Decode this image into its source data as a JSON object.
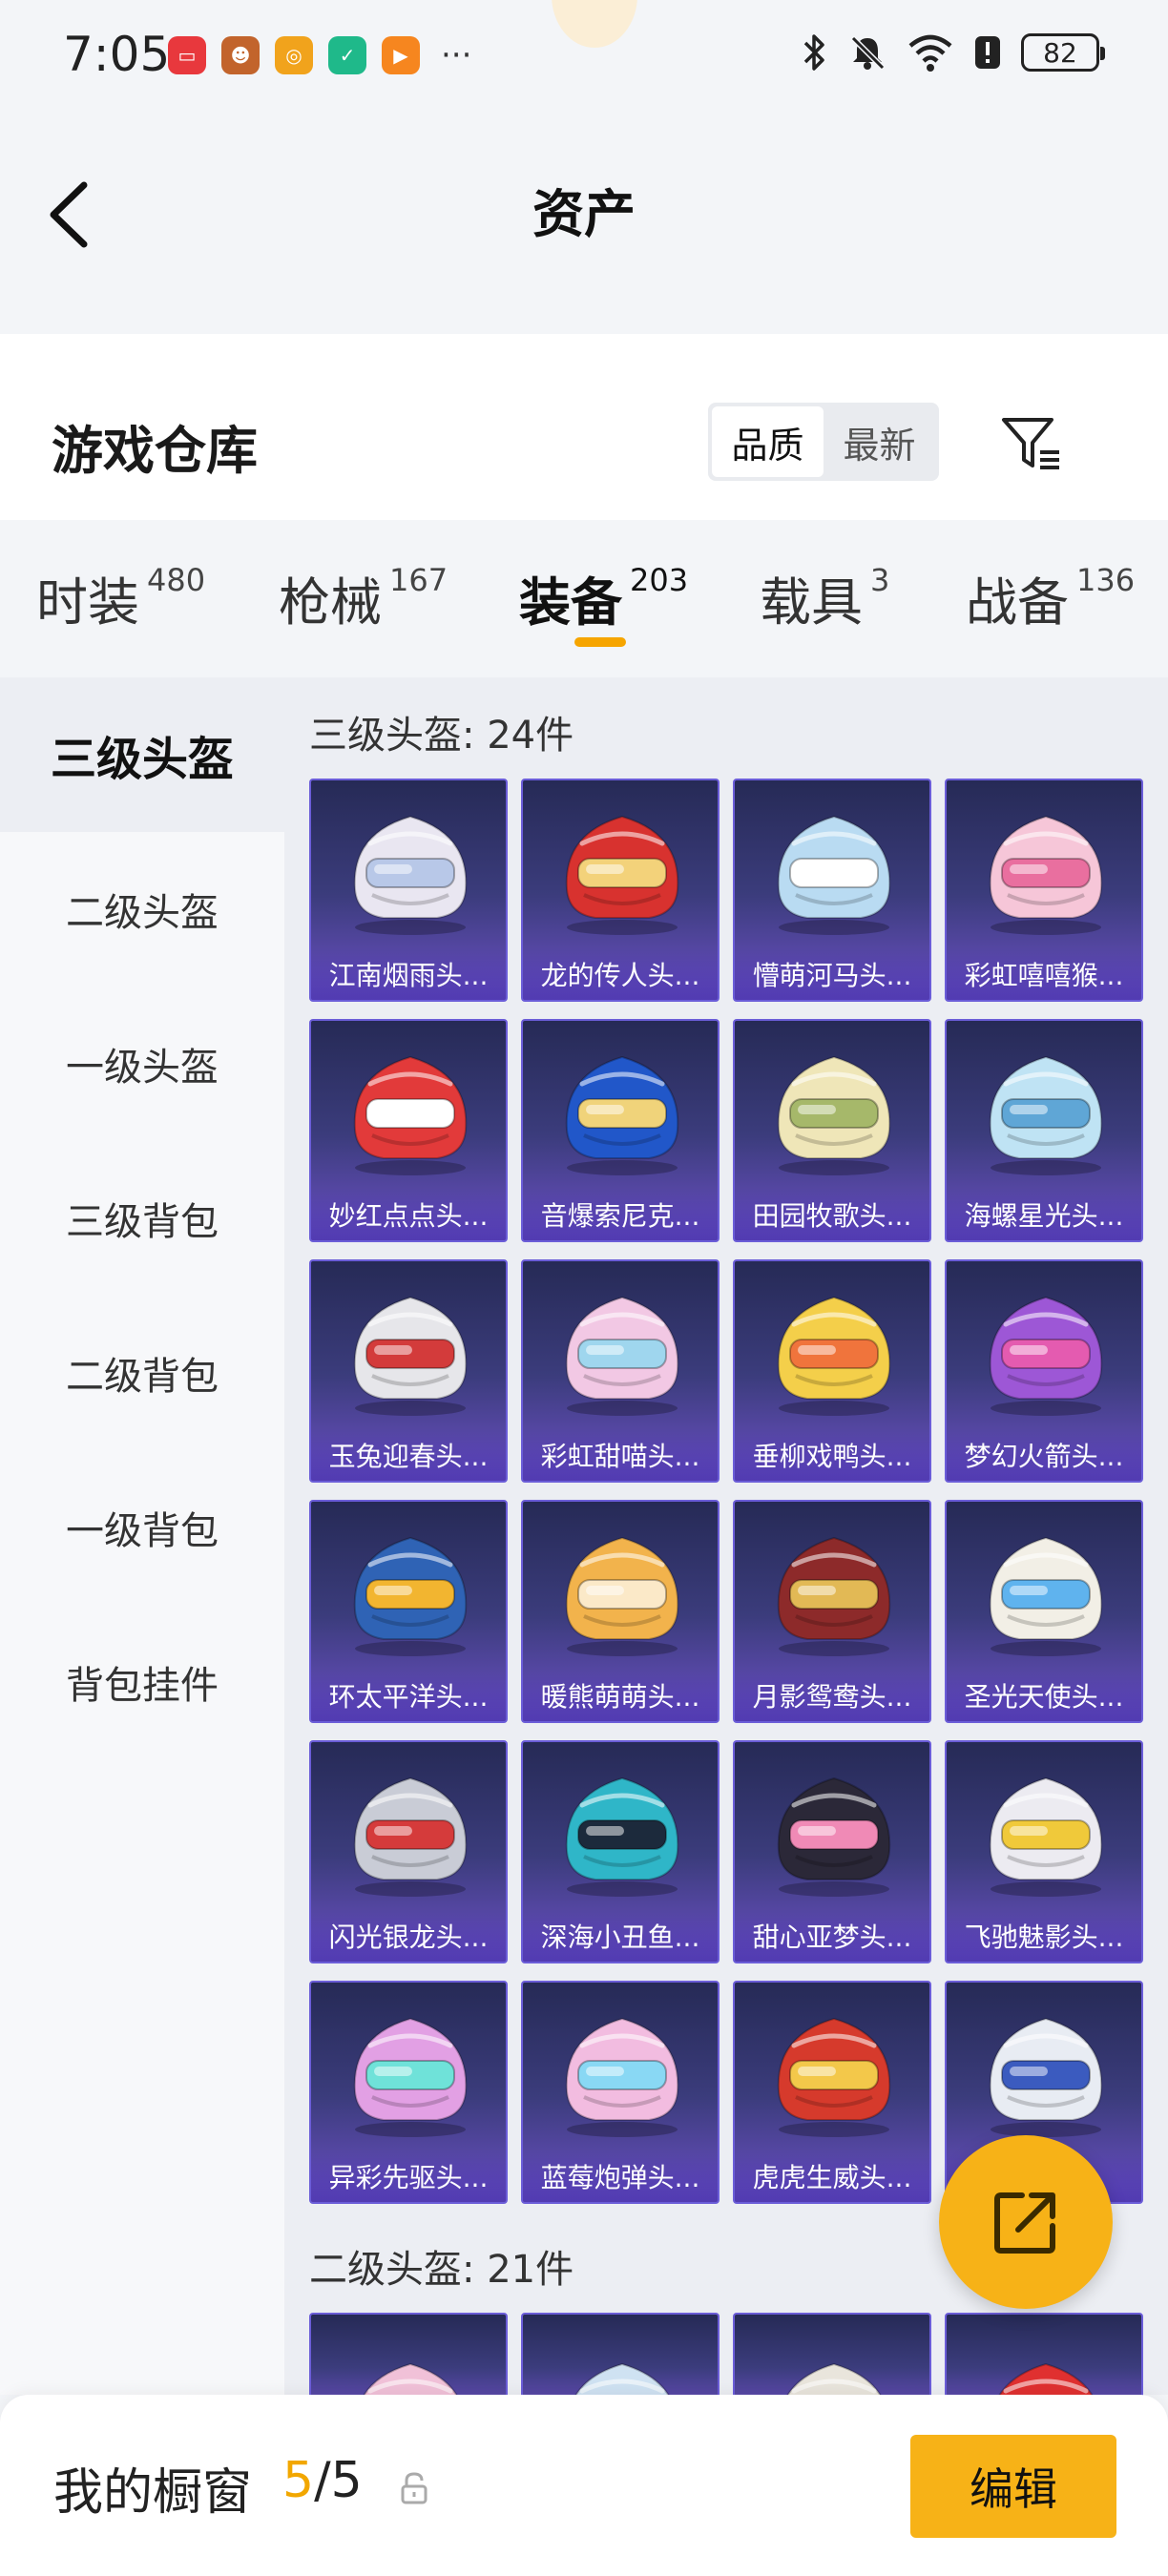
{
  "status_bar": {
    "time": "7:05",
    "apps": [
      {
        "name": "huawei-app-icon",
        "color": "#e8383d",
        "glyph": "▭"
      },
      {
        "name": "game-avatar-icon",
        "color": "#c2642c",
        "glyph": "☻"
      },
      {
        "name": "music-app-icon",
        "color": "#f1a31c",
        "glyph": "◎"
      },
      {
        "name": "security-app-icon",
        "color": "#1fb98a",
        "glyph": "✓"
      },
      {
        "name": "video-app-icon",
        "color": "#f6861f",
        "glyph": "▶"
      }
    ],
    "more": "···",
    "battery": "82"
  },
  "header": {
    "title": "资产"
  },
  "warehouse": {
    "title": "游戏仓库",
    "sort_options": [
      "品质",
      "最新"
    ],
    "active_sort": "品质"
  },
  "tabs": [
    {
      "label": "时装",
      "count": "480"
    },
    {
      "label": "枪械",
      "count": "167"
    },
    {
      "label": "装备",
      "count": "203",
      "active": true
    },
    {
      "label": "载具",
      "count": "3"
    },
    {
      "label": "战备",
      "count": "136"
    }
  ],
  "sidebar": {
    "items": [
      "三级头盔",
      "二级头盔",
      "一级头盔",
      "三级背包",
      "二级背包",
      "一级背包",
      "背包挂件"
    ],
    "active": "三级头盔"
  },
  "sections": [
    {
      "title": "三级头盔: 24件",
      "items": [
        {
          "name": "江南烟雨头...",
          "color": "#e9e6f1",
          "accent": "#b8c8e8"
        },
        {
          "name": "龙的传人头...",
          "color": "#d8322f",
          "accent": "#f3d27a"
        },
        {
          "name": "懵萌河马头...",
          "color": "#b9dbf2",
          "accent": "#ffffff"
        },
        {
          "name": "彩虹嘻嘻猴...",
          "color": "#f6c6d8",
          "accent": "#e96f9f"
        },
        {
          "name": "妙红点点头...",
          "color": "#e23a3a",
          "accent": "#ffffff"
        },
        {
          "name": "音爆索尼克...",
          "color": "#2157c9",
          "accent": "#f0d37a"
        },
        {
          "name": "田园牧歌头...",
          "color": "#efe6b8",
          "accent": "#a6b86a"
        },
        {
          "name": "海螺星光头...",
          "color": "#bfe3f4",
          "accent": "#5fa6d6"
        },
        {
          "name": "玉兔迎春头...",
          "color": "#e6e6ea",
          "accent": "#d33b3b"
        },
        {
          "name": "彩虹甜喵头...",
          "color": "#f2c8e4",
          "accent": "#9fd6ee"
        },
        {
          "name": "垂柳戏鸭头...",
          "color": "#f4cf4a",
          "accent": "#f0743c"
        },
        {
          "name": "梦幻火箭头...",
          "color": "#9d57d6",
          "accent": "#e45bb0"
        },
        {
          "name": "环太平洋头...",
          "color": "#2f63b5",
          "accent": "#f2b530"
        },
        {
          "name": "暖熊萌萌头...",
          "color": "#f2b34c",
          "accent": "#fbe9c8"
        },
        {
          "name": "月影鸳鸯头...",
          "color": "#8d2a2a",
          "accent": "#e2b955"
        },
        {
          "name": "圣光天使头...",
          "color": "#f2efe6",
          "accent": "#5fb3ee"
        },
        {
          "name": "闪光银龙头...",
          "color": "#c9ccd6",
          "accent": "#d53b3b"
        },
        {
          "name": "深海小丑鱼...",
          "color": "#2fb6c8",
          "accent": "#1c2a3c"
        },
        {
          "name": "甜心亚梦头...",
          "color": "#2b2838",
          "accent": "#f08ab6"
        },
        {
          "name": "飞驰魅影头...",
          "color": "#ecebf1",
          "accent": "#f0c93a"
        },
        {
          "name": "异彩先驱头...",
          "color": "#e2a0e4",
          "accent": "#6fe2d9"
        },
        {
          "name": "蓝莓炮弹头...",
          "color": "#f2bce0",
          "accent": "#89d8f4"
        },
        {
          "name": "虎虎生威头...",
          "color": "#d63a2c",
          "accent": "#f3c84a"
        },
        {
          "name": "",
          "color": "#e8ecf3",
          "accent": "#3b5bbf"
        }
      ]
    },
    {
      "title": "二级头盔: 21件",
      "items": [
        {
          "name": "",
          "color": "#f1c1d8",
          "accent": "#8fcff1"
        },
        {
          "name": "",
          "color": "#cfe2f2",
          "accent": "#ffffff"
        },
        {
          "name": "",
          "color": "#e9e5dc",
          "accent": "#3a4c8c"
        },
        {
          "name": "",
          "color": "#e03030",
          "accent": "#ffffff"
        }
      ]
    }
  ],
  "bottom_bar": {
    "label": "我的橱窗",
    "count_current": "5",
    "count_sep": "/",
    "count_total": "5",
    "edit_label": "编辑"
  },
  "colors": {
    "accent": "#f7b217",
    "tab_indicator": "#f6a500",
    "card_border": "#6b5dd8"
  }
}
